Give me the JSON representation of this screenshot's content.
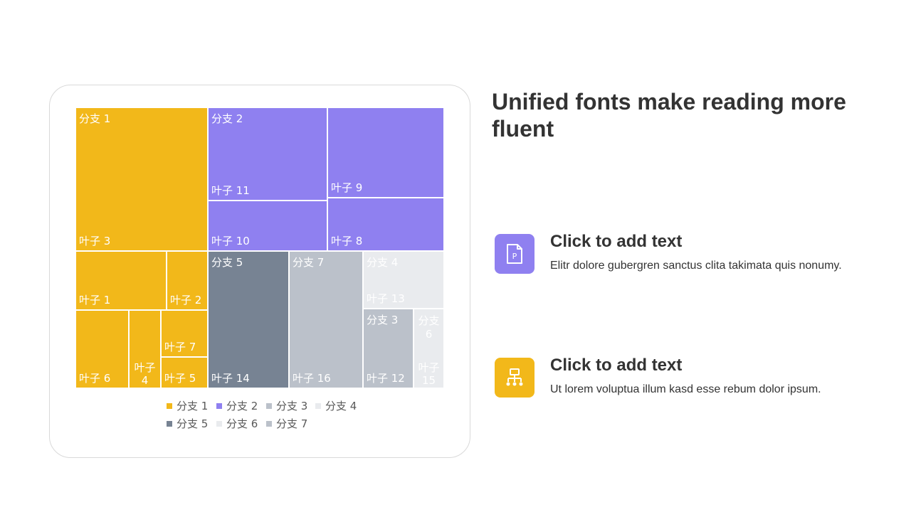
{
  "headline": "Unified fonts make reading more fluent",
  "features": [
    {
      "title": "Click to add text",
      "description": "Elitr dolore gubergren sanctus clita takimata quis nonumy.",
      "icon": "document-p-icon",
      "color": "#8F80F0"
    },
    {
      "title": "Click to add text",
      "description": "Ut lorem voluptua illum kasd esse rebum dolor ipsum.",
      "icon": "org-chart-icon",
      "color": "#F2B81A"
    }
  ],
  "chart_data": {
    "type": "treemap",
    "branches": [
      {
        "name": "分支 1",
        "color": "#F2B81A",
        "leaves": [
          {
            "name": "叶子 3",
            "value": 37.2
          },
          {
            "name": "叶子 1",
            "value": 10.4
          },
          {
            "name": "叶子 2",
            "value": 4.8
          },
          {
            "name": "叶子 6",
            "value": 8.0
          },
          {
            "name": "叶子 4",
            "value": 4.7
          },
          {
            "name": "叶子 7",
            "value": 4.2
          },
          {
            "name": "叶子 5",
            "value": 4.4
          }
        ]
      },
      {
        "name": "分支 2",
        "color": "#8F80F0",
        "leaves": [
          {
            "name": "叶子 11",
            "value": 21.4
          },
          {
            "name": "叶子 10",
            "value": 11.9
          },
          {
            "name": "叶子 9",
            "value": 20.3
          },
          {
            "name": "叶子 8",
            "value": 11.9
          }
        ]
      },
      {
        "name": "分支 5",
        "color": "#778393",
        "leaves": [
          {
            "name": "叶子 14",
            "value": 21.4
          }
        ]
      },
      {
        "name": "分支 7",
        "color": "#BBC1CA",
        "leaves": [
          {
            "name": "叶子 16",
            "value": 19.3
          }
        ]
      },
      {
        "name": "分支 4",
        "color": "#E9EBEE",
        "leaves": [
          {
            "name": "叶子 13",
            "value": 9.0
          }
        ]
      },
      {
        "name": "分支 3",
        "color": "#BBC1CA",
        "leaves": [
          {
            "name": "叶子 12",
            "value": 7.3
          }
        ]
      },
      {
        "name": "分支 6",
        "color": "#E9EBEE",
        "leaves": [
          {
            "name": "叶子 15",
            "value": 4.2
          }
        ]
      }
    ],
    "legend": [
      {
        "name": "分支 1",
        "color": "#F2B81A"
      },
      {
        "name": "分支 2",
        "color": "#8F80F0"
      },
      {
        "name": "分支 3",
        "color": "#BBC1CA"
      },
      {
        "name": "分支 4",
        "color": "#E9EBEE"
      },
      {
        "name": "分支 5",
        "color": "#778393"
      },
      {
        "name": "分支 6",
        "color": "#E9EBEE"
      },
      {
        "name": "分支 7",
        "color": "#BBC1CA"
      }
    ],
    "legend_position": "bottom"
  }
}
